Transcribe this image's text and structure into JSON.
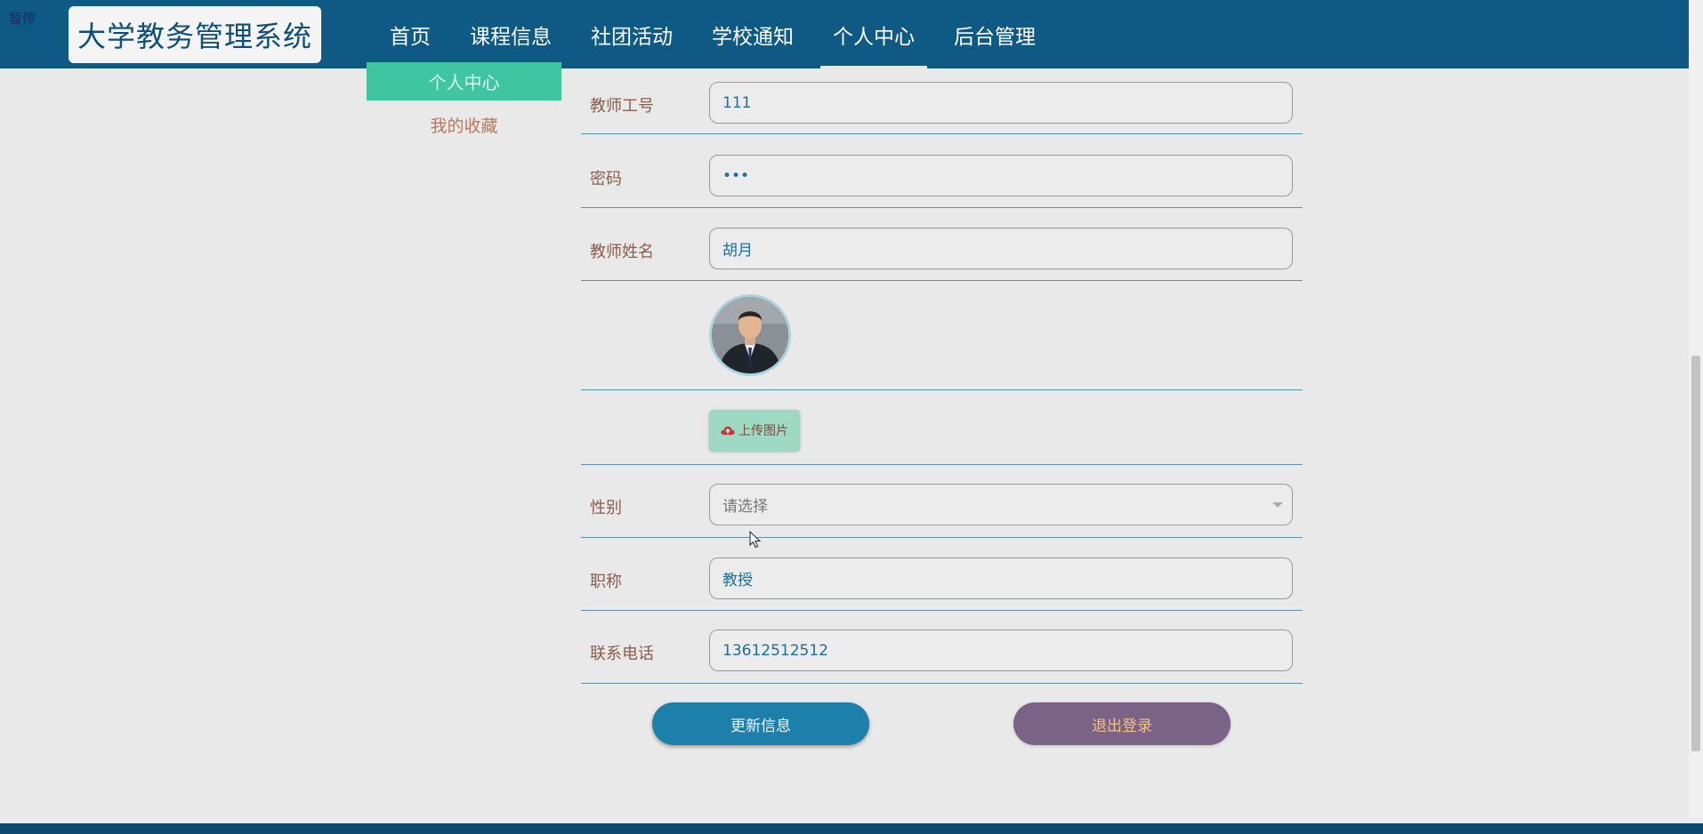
{
  "header": {
    "pause_tag": "暂停",
    "brand": "大学教务管理系统",
    "nav": [
      {
        "label": "首页",
        "active": false
      },
      {
        "label": "课程信息",
        "active": false
      },
      {
        "label": "社团活动",
        "active": false
      },
      {
        "label": "学校通知",
        "active": false
      },
      {
        "label": "个人中心",
        "active": true
      },
      {
        "label": "后台管理",
        "active": false
      }
    ]
  },
  "sidebar": {
    "items": [
      {
        "label": "个人中心",
        "active": true
      },
      {
        "label": "我的收藏",
        "active": false
      }
    ]
  },
  "form": {
    "teacher_id_label": "教师工号",
    "teacher_id_value": "111",
    "password_label": "密码",
    "password_value": "•••",
    "name_label": "教师姓名",
    "name_value": "胡月",
    "upload_label": "上传图片",
    "gender_label": "性别",
    "gender_placeholder": "请选择",
    "title_label": "职称",
    "title_value": "教授",
    "phone_label": "联系电话",
    "phone_value": "13612512512"
  },
  "actions": {
    "update_label": "更新信息",
    "logout_label": "退出登录"
  },
  "colors": {
    "header_bg": "#0e5a84",
    "accent_green": "#3fc6a0",
    "update_button": "#1d80ab",
    "logout_button": "#7a6386"
  },
  "icons": [
    "cloud-upload-icon",
    "chevron-down-icon",
    "mouse-pointer-icon"
  ]
}
